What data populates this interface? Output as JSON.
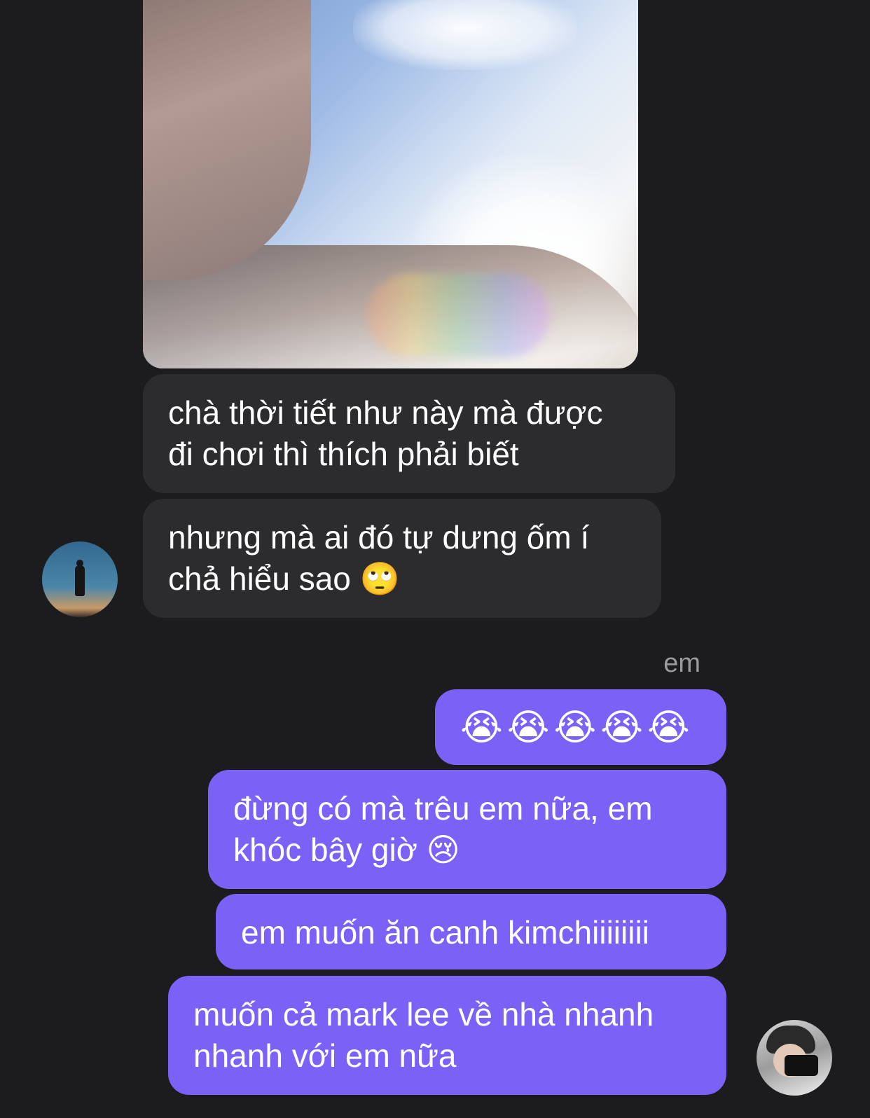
{
  "thread": {
    "incoming": [
      {
        "text_lines": [
          "chà thời tiết như này mà được",
          "đi chơi thì thích phải biết"
        ]
      },
      {
        "text_lines": [
          "nhưng mà ai đó tự dưng ốm í",
          "chả hiểu sao 🙄"
        ]
      }
    ],
    "my_sender_label": "em",
    "outgoing": [
      {
        "text_lines": [
          "😭😭😭😭😭"
        ]
      },
      {
        "text_lines": [
          "đừng có mà trêu em nữa, em",
          "khóc bây giờ 😢"
        ]
      },
      {
        "text_lines": [
          "em muốn ăn canh kimchiiiiiiii"
        ]
      },
      {
        "text_lines": [
          "muốn cả mark lee về nhà nhanh",
          "nhanh với em nữa"
        ]
      }
    ]
  },
  "theme": {
    "background": "#1c1c1e",
    "incoming_bubble": "#2c2c2e",
    "outgoing_bubble": "#7b61f5",
    "label_color": "#9a9a9f"
  }
}
